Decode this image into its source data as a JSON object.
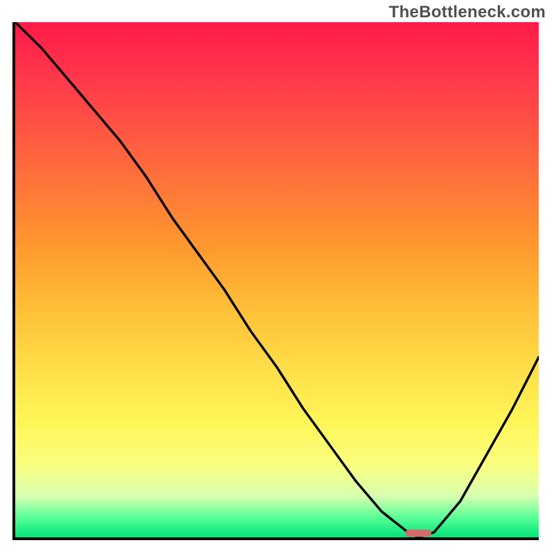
{
  "watermark": "TheBottleneck.com",
  "colors": {
    "gradient_top": "#ff1a49",
    "gradient_mid": "#ffc038",
    "gradient_bottom": "#00e57a",
    "axis": "#000000",
    "curve": "#000000",
    "marker": "#d46a6a"
  },
  "chart_data": {
    "type": "line",
    "title": "",
    "xlabel": "",
    "ylabel": "",
    "xlim": [
      0,
      100
    ],
    "ylim": [
      0,
      100
    ],
    "grid": false,
    "legend": false,
    "annotations": [
      "TheBottleneck.com"
    ],
    "series": [
      {
        "name": "curve",
        "x": [
          0,
          5,
          10,
          15,
          20,
          25,
          30,
          35,
          40,
          45,
          50,
          55,
          60,
          65,
          70,
          75,
          77,
          80,
          85,
          90,
          95,
          100
        ],
        "y": [
          100,
          95,
          89,
          83,
          77,
          70,
          62,
          55,
          48,
          40,
          33,
          25,
          18,
          11,
          5,
          1,
          0,
          1,
          7,
          16,
          25,
          35
        ]
      }
    ],
    "marker": {
      "shape": "rounded-bar",
      "x_center": 77,
      "y": 0.8,
      "width_pct": 5,
      "height_pct": 1.4,
      "fill": "#d46a6a"
    }
  }
}
